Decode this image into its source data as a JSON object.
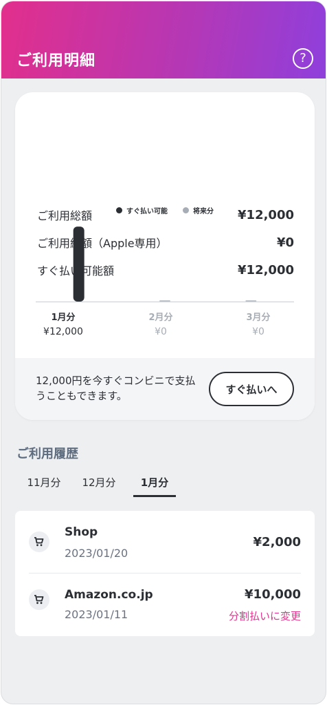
{
  "header": {
    "title": "ご利用明細",
    "help_icon": "?"
  },
  "summary": {
    "rows": [
      {
        "label": "ご利用総額",
        "amount": "¥12,000"
      },
      {
        "label": "ご利用総額（Apple専用）",
        "amount": "¥0"
      },
      {
        "label": "すぐ払い可能額",
        "amount": "¥12,000"
      }
    ]
  },
  "chart_data": {
    "type": "bar",
    "categories": [
      "1月分",
      "2月分",
      "3月分"
    ],
    "series": [
      {
        "name": "すぐ払い可能",
        "values": [
          12000,
          0,
          0
        ],
        "color": "#2b2e33"
      },
      {
        "name": "将来分",
        "values": [
          0,
          0,
          0
        ],
        "color": "#a7adb5"
      }
    ],
    "value_labels": [
      "¥12,000",
      "¥0",
      "¥0"
    ],
    "ylim": [
      0,
      13000
    ],
    "legend": "top-center"
  },
  "pay_now": {
    "message": "12,000円を今すぐコンビニで支払うこともできます。",
    "button": "すぐ払いへ"
  },
  "history": {
    "title": "ご利用履歴",
    "tabs": [
      {
        "label": "11月分",
        "active": false
      },
      {
        "label": "12月分",
        "active": false
      },
      {
        "label": "1月分",
        "active": true
      }
    ],
    "items": [
      {
        "name": "Shop",
        "date": "2023/01/20",
        "amount": "¥2,000",
        "icon": "cart-icon"
      },
      {
        "name": "Amazon.co.jp",
        "date": "2023/01/11",
        "amount": "¥10,000",
        "action": "分割払いに変更",
        "icon": "cart-icon"
      }
    ]
  },
  "colors": {
    "accent": "#e0358e",
    "header_start": "#e22f8c",
    "header_end": "#8f3fdc",
    "dark": "#2b2e33",
    "muted": "#a7adb5"
  }
}
